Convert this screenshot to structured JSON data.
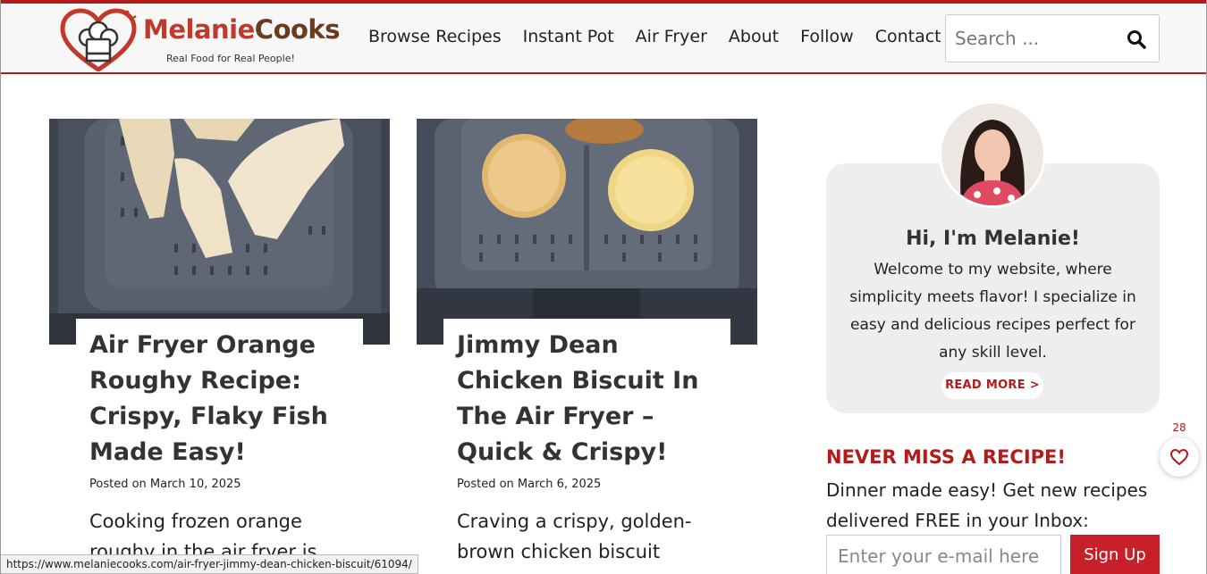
{
  "header": {
    "logo": {
      "brand_part1": "Melanie",
      "brand_part2": "Cooks",
      "tagline": "Real Food for Real People!"
    },
    "nav": [
      "Browse Recipes",
      "Instant Pot",
      "Air Fryer",
      "About",
      "Follow",
      "Contact"
    ],
    "search": {
      "placeholder": "Search ..."
    }
  },
  "posts": [
    {
      "title": "Air Fryer Orange Roughy Recipe: Crispy, Flaky Fish Made Easy!",
      "meta": "Posted on March 10, 2025",
      "excerpt": "Cooking frozen orange roughy in the air fryer is the"
    },
    {
      "title": "Jimmy Dean Chicken Biscuit In The Air Fryer – Quick & Crispy!",
      "meta": "Posted on March 6, 2025",
      "excerpt": "Craving a crispy, golden-brown chicken biscuit"
    }
  ],
  "sidebar": {
    "about": {
      "heading": "Hi, I'm Melanie!",
      "text": "Welcome to my website, where simplicity meets flavor! I specialize in easy and delicious recipes perfect for any skill level.",
      "read_more": "READ MORE >"
    },
    "newsletter": {
      "title": "NEVER MISS A RECIPE!",
      "text": "Dinner made easy! Get new recipes delivered FREE in your Inbox:",
      "email_placeholder": "Enter your e-mail here",
      "button": "Sign Up"
    }
  },
  "favorite": {
    "count": "28"
  },
  "status_url": "https://www.melaniecooks.com/air-fryer-jimmy-dean-chicken-biscuit/61094/",
  "colors": {
    "accent": "#b31b1b",
    "button": "#c8202a",
    "logo_red": "#c0392b",
    "logo_brown": "#6a3b1f"
  }
}
